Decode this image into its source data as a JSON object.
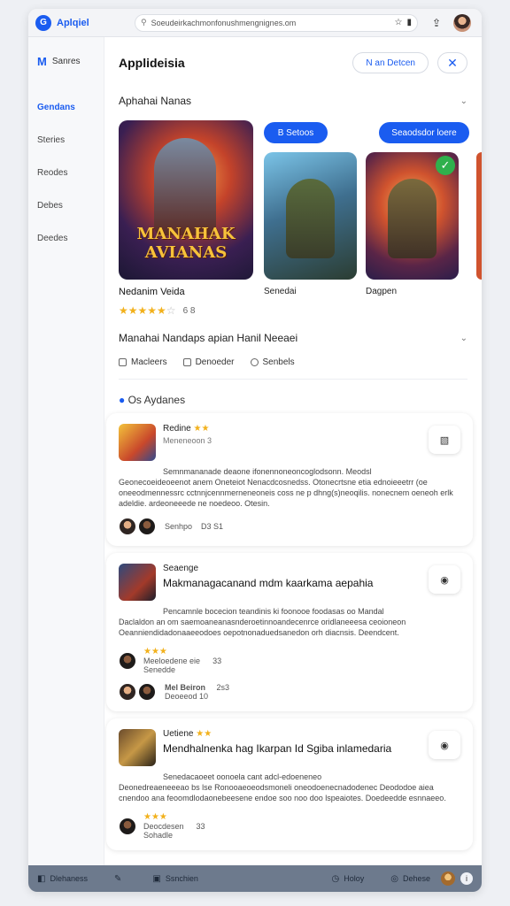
{
  "browser": {
    "app_name": "Aplqiel",
    "url": "Soeudeirkachmonfonushmengnignes.om"
  },
  "sidebar": {
    "brand_mark": "M",
    "title": "Sanres",
    "items": [
      {
        "label": "Gendans",
        "active": true
      },
      {
        "label": "Steries"
      },
      {
        "label": "Reodes"
      },
      {
        "label": "Debes"
      },
      {
        "label": "Deedes"
      }
    ]
  },
  "header": {
    "title": "Applideisia",
    "action_label": "N an Detcen",
    "close_label": "✕"
  },
  "section": {
    "label": "Aphahai Nanas"
  },
  "gallery": {
    "featured_title_art": "MANAHAK AVIANAS",
    "button1": "B Setoos",
    "button2": "Seaodsdor loere",
    "games": [
      {
        "name": "Nedanim Veida"
      },
      {
        "name": "Senedai"
      },
      {
        "name": "Dagpen"
      }
    ],
    "rating_count": "6 8"
  },
  "filter_section": {
    "label": "Manahai Nandaps apian Hanil Neeaei",
    "options": [
      "Macleers",
      "Denoeder",
      "Senbels"
    ]
  },
  "reviews": {
    "heading": "Os Aydanes",
    "items": [
      {
        "name": "Redine",
        "stars": "★★",
        "sub": "Meneneoon 3",
        "body_lead": "Semnmananade deaone ifonennoneoncoglodsonn. Meodsl",
        "body": "Geonecoeideoeenot anem Oneteiot Nenacdcosnedss. Otonecrtsne etia ednoieeetrr (oe oneeodmennessrc cctnnjcennmerneneoneis coss ne p dhng(s)neoqilis. nonecnem oeneoh erlk adeldie. ardeoneeede ne noedeoo. Otesin.",
        "foot_text": "Senhpo",
        "foot_num": "D3 S1"
      },
      {
        "name": "Seaenge",
        "headline": "Makmanagacanand mdm kaarkama aepahia",
        "body_lead": "Pencamnle bocecion teandinis ki foonooe foodasas oo Mandal",
        "body": "Daclaldon an om saemoaneanasnderoetinnoandecenrce oridlaneeesa ceoioneon Oeanniendidadonaaeeodoes oepotnonaduedsanedon orh diacnsis. Deendcent.",
        "sub_stars": "★★★",
        "sub_name": "Meeloedene eie",
        "sub_num": "33",
        "sub_sub": "Senedde",
        "foot_name": "Mel Beiron",
        "foot_num": "2s3",
        "foot_sub": "Deoeeod 10"
      },
      {
        "name": "Uetiene",
        "stars": "★★",
        "headline": "Mendhalnenka hag Ikarpan Id Sgiba inlamedaria",
        "body_lead": "Senedacaoeet oonoela cant adcl-edoeneneo",
        "body": "Deonedreaeneeeao bs lse Ronooaeoeodsmoneli oneodoenecnadodenec Deododoe aiea cnendoo ana feoomdlodaonebeesene endoe soo noo doo lspeaiotes. Doedeedde esnnaeeo.",
        "sub_stars": "★★★",
        "sub_name": "Deocdesen",
        "sub_num": "33",
        "sub_sub": "Sohadle"
      }
    ]
  },
  "bottom_bar": {
    "item1": "Dlehaness",
    "item2": "Ssnchien",
    "item3": "Holoy",
    "item4": "Dehese",
    "info": "i"
  },
  "colors": {
    "accent": "#1a5cf0",
    "star": "#f2b11c",
    "bottom_bar": "#6d7a8d"
  }
}
